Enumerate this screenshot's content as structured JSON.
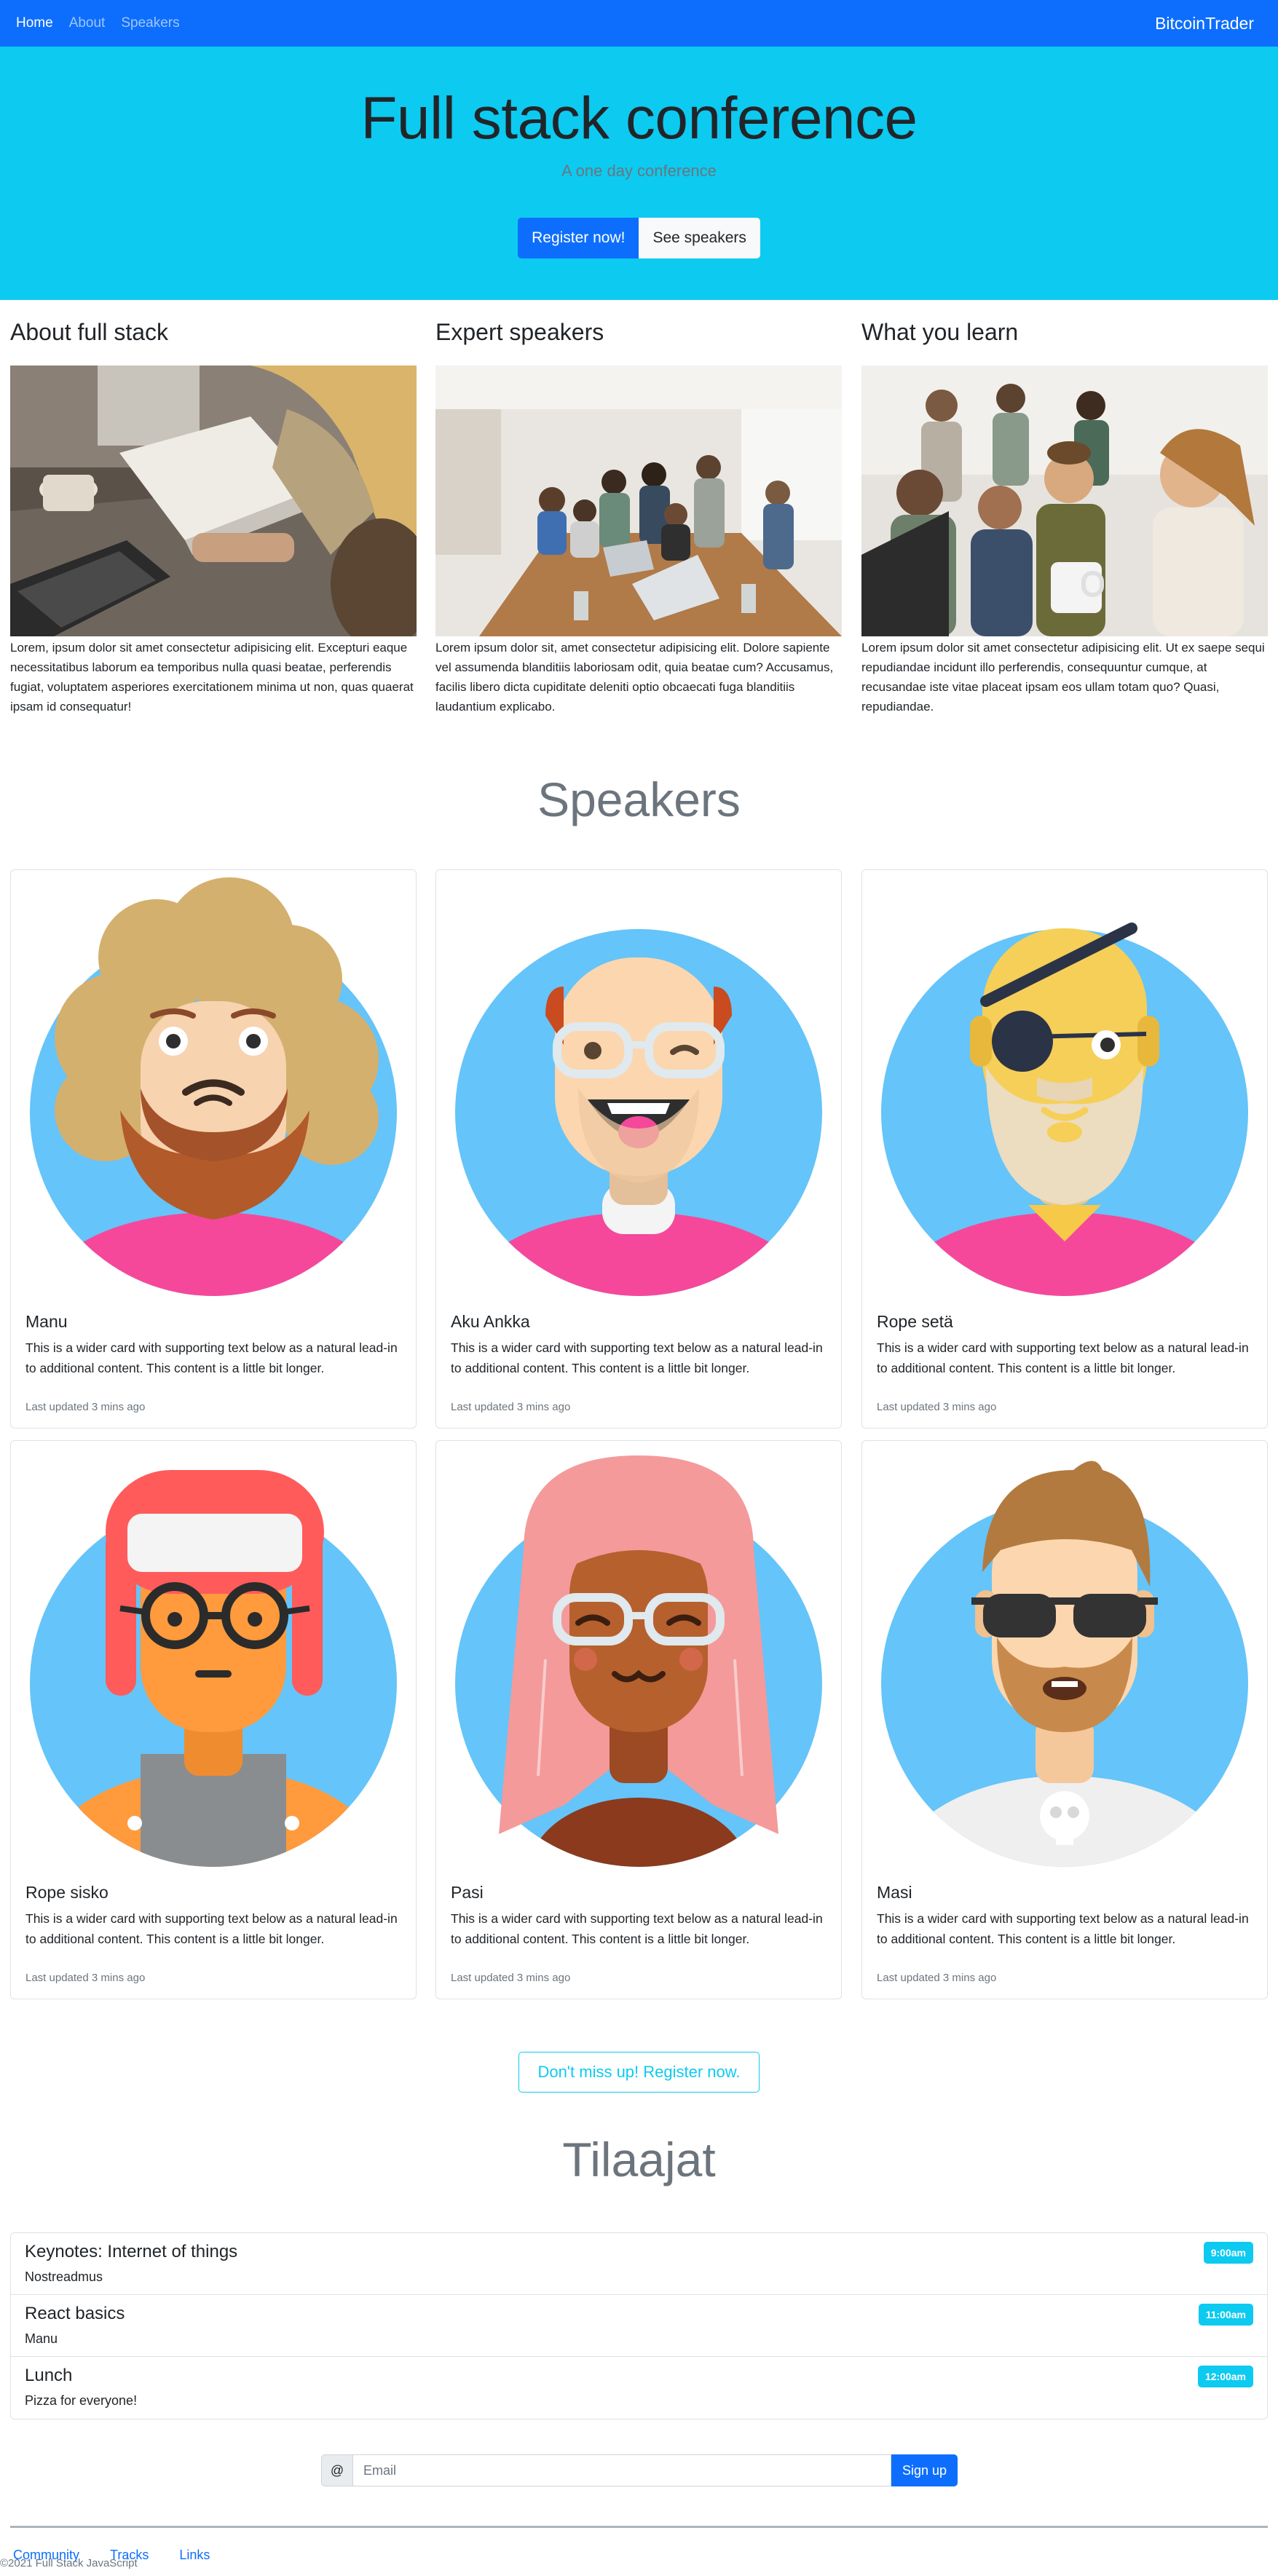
{
  "nav": {
    "links": [
      "Home",
      "About",
      "Speakers"
    ],
    "brand": "BitcoinTrader"
  },
  "hero": {
    "title": "Full stack conference",
    "subtitle": "A one day conference",
    "primary_button": "Register now!",
    "secondary_button": "See speakers"
  },
  "about": [
    {
      "title": "About full stack",
      "text": "Lorem, ipsum dolor sit amet consectetur adipisicing elit. Excepturi eaque necessitatibus laborum ea temporibus nulla quasi beatae, perferendis fugiat, voluptatem asperiores exercitationem minima ut non, quas quaerat ipsam id consequatur!"
    },
    {
      "title": "Expert speakers",
      "text": "Lorem ipsum dolor sit, amet consectetur adipisicing elit. Dolore sapiente vel assumenda blanditiis laboriosam odit, quia beatae cum? Accusamus, facilis libero dicta cupiditate deleniti optio obcaecati fuga blanditiis laudantium explicabo."
    },
    {
      "title": "What you learn",
      "text": "Lorem ipsum dolor sit amet consectetur adipisicing elit. Ut ex saepe sequi repudiandae incidunt illo perferendis, consequuntur cumque, at recusandae iste vitae placeat ipsam eos ullam totam quo? Quasi, repudiandae."
    }
  ],
  "speakers_title": "Speakers",
  "speakers": [
    {
      "name": "Manu",
      "text": "This is a wider card with supporting text below as a natural lead-in to additional content. This content is a little bit longer.",
      "updated": "Last updated 3 mins ago"
    },
    {
      "name": "Aku Ankka",
      "text": "This is a wider card with supporting text below as a natural lead-in to additional content. This content is a little bit longer.",
      "updated": "Last updated 3 mins ago"
    },
    {
      "name": "Rope setä",
      "text": "This is a wider card with supporting text below as a natural lead-in to additional content. This content is a little bit longer.",
      "updated": "Last updated 3 mins ago"
    },
    {
      "name": "Rope sisko",
      "text": "This is a wider card with supporting text below as a natural lead-in to additional content. This content is a little bit longer.",
      "updated": "Last updated 3 mins ago"
    },
    {
      "name": "Pasi",
      "text": "This is a wider card with supporting text below as a natural lead-in to additional content. This content is a little bit longer.",
      "updated": "Last updated 3 mins ago"
    },
    {
      "name": "Masi",
      "text": "This is a wider card with supporting text below as a natural lead-in to additional content. This content is a little bit longer.",
      "updated": "Last updated 3 mins ago"
    }
  ],
  "cta": "Don't miss up! Register now.",
  "schedule_title": "Tilaajat",
  "schedule": [
    {
      "title": "Keynotes: Internet of things",
      "speaker": "Nostreadmus",
      "time": "9:00am"
    },
    {
      "title": "React basics",
      "speaker": "Manu",
      "time": "11:00am"
    },
    {
      "title": "Lunch",
      "speaker": "Pizza for everyone!",
      "time": "12:00am"
    }
  ],
  "signup": {
    "prefix": "@",
    "placeholder": "Email",
    "button": "Sign up"
  },
  "footer": {
    "links": [
      "Community",
      "Tracks",
      "Links"
    ],
    "copyright": "©2021 Full Stack JavaScript"
  },
  "colors": {
    "primary": "#0d6efd",
    "info": "#0dcaf0",
    "avatar_bg": "#65c4f9",
    "shirt": "#f6489a"
  }
}
